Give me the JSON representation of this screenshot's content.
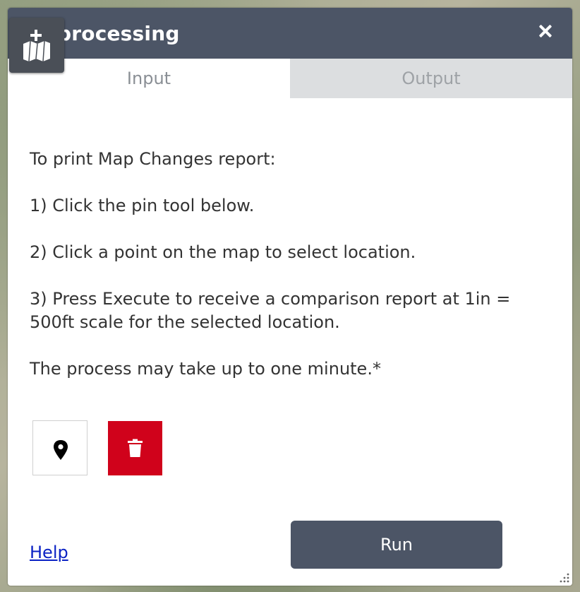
{
  "panel": {
    "title": "processing",
    "tabs": [
      {
        "label": "Input",
        "active": true
      },
      {
        "label": "Output",
        "active": false
      }
    ]
  },
  "instructions": {
    "line1": "To print Map Changes report:",
    "line2": "1) Click the pin tool below.",
    "line3": "2) Click a point on the map to select location.",
    "line4": "3) Press Execute to receive a comparison report at 1in = 500ft scale for the selected location.",
    "line5": "The process may take up to one minute.*"
  },
  "tools": {
    "pin_icon": "map-pin-icon",
    "delete_icon": "trash-icon",
    "delete_color": "#d0021b"
  },
  "footer": {
    "help_label": "Help",
    "run_label": "Run"
  },
  "colors": {
    "header": "#4c5566",
    "link": "#0b22c4"
  }
}
